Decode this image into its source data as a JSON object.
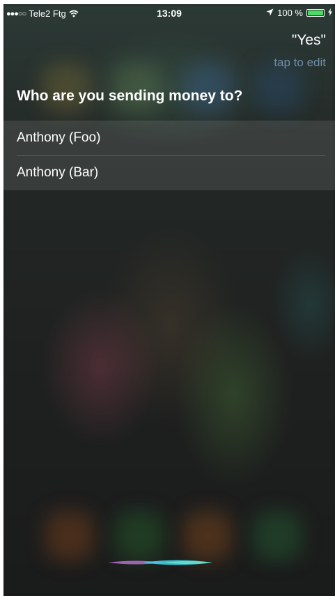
{
  "status_bar": {
    "signal": "●●●○○",
    "carrier": "Tele2 Ftg",
    "time": "13:09",
    "battery_percent": "100 %",
    "battery_level": 1.0
  },
  "siri": {
    "utterance": "\"Yes\"",
    "tap_to_edit": "tap to edit",
    "question": "Who are you sending money to?",
    "options": [
      {
        "label": "Anthony (Foo)"
      },
      {
        "label": "Anthony (Bar)"
      }
    ]
  },
  "colors": {
    "battery": "#4cd964",
    "tap_to_edit": "#6f8fa6",
    "background": "#1b1d1f"
  },
  "icons": [
    "wifi-icon",
    "location-arrow-icon",
    "battery-icon",
    "charging-icon",
    "siri-waveform-icon"
  ]
}
